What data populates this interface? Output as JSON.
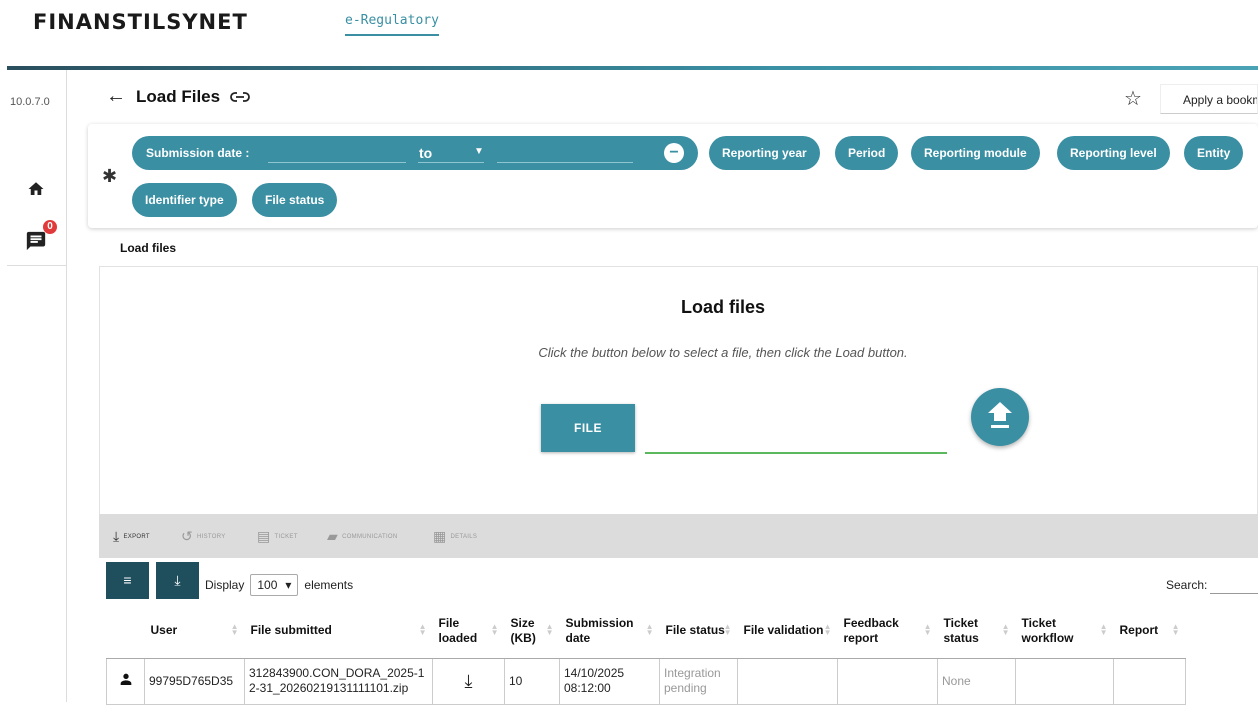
{
  "header": {
    "brand": "FINANSTILSYNET",
    "app_link": "e-Regulatory"
  },
  "nav": {
    "version": "10.0.7.0",
    "notification_count": "0"
  },
  "page": {
    "title": "Load Files",
    "bookmark_placeholder": "Apply a bookm"
  },
  "filters": {
    "date_label": "Submission date :",
    "to_label": "to",
    "pills": [
      "Reporting year",
      "Period",
      "Reporting module",
      "Reporting level",
      "Entity",
      "Identifier type",
      "File status"
    ]
  },
  "section": {
    "label": "Load files"
  },
  "load_panel": {
    "title": "Load files",
    "subtitle": "Click the button below to select a file, then click the Load button.",
    "file_button": "FILE"
  },
  "toolbar": {
    "export": "EXPORT",
    "history": "HISTORY",
    "ticket": "TICKET",
    "communication": "COMMUNICATION",
    "details": "DETAILS"
  },
  "table_controls": {
    "display_label": "Display",
    "display_value": "100",
    "elements_label": "elements",
    "search_label": "Search:"
  },
  "table": {
    "headers": {
      "user": "User",
      "file_submitted": "File submitted",
      "file_loaded": "File loaded",
      "size": "Size (KB)",
      "submission_date": "Submission date",
      "file_status": "File status",
      "file_validation": "File validation",
      "feedback_report": "Feedback report",
      "ticket_status": "Ticket status",
      "ticket_workflow": "Ticket workflow",
      "report": "Report"
    },
    "rows": [
      {
        "user": "99795D765D35",
        "file_submitted": "312843900.CON_DORA_2025-12-31_20260219131111101.zip",
        "size": "10",
        "submission_date": "14/10/2025 08:12:00",
        "file_status": "Integration pending",
        "file_validation": "",
        "feedback_report": "",
        "ticket_status": "None",
        "ticket_workflow": "",
        "report": ""
      }
    ]
  },
  "colors": {
    "accent": "#3a8fa3",
    "dark": "#1f4e5c",
    "badge": "#e03a3a",
    "file_line": "#5cb85c"
  }
}
